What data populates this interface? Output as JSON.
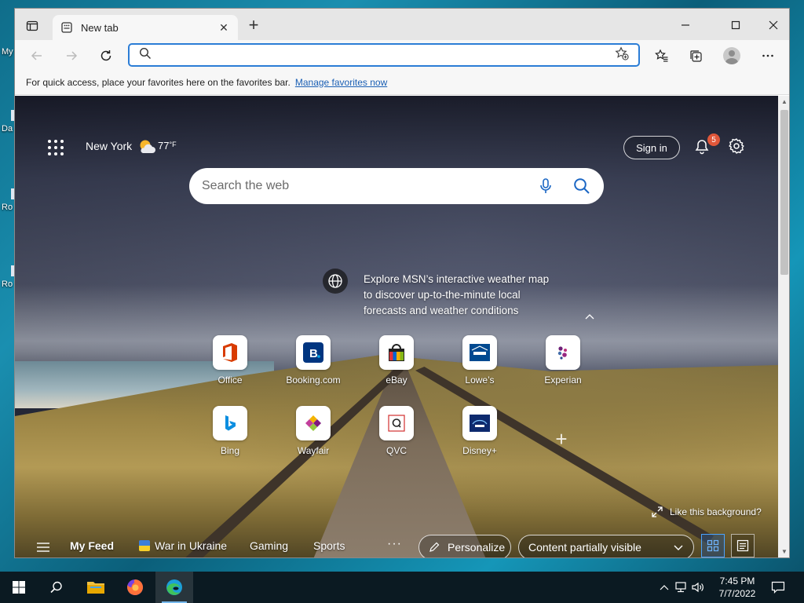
{
  "desktop": {
    "labels": [
      "My",
      "Da",
      "Ro",
      "Ro"
    ]
  },
  "browser": {
    "tab": {
      "title": "New tab"
    },
    "address": {
      "value": "",
      "placeholder": ""
    },
    "favorites_bar": {
      "message": "For quick access, place your favorites here on the favorites bar.",
      "link": "Manage favorites now"
    }
  },
  "newtab": {
    "location": "New York",
    "temperature": "77",
    "temp_unit": "°F",
    "sign_in": "Sign in",
    "notification_count": "5",
    "search": {
      "placeholder": "Search the web"
    },
    "explore": {
      "line1": "Explore MSN’s interactive weather map",
      "line2": "to discover up-to-the-minute local",
      "line3": "forecasts and weather conditions"
    },
    "quick_links": [
      {
        "label": "Office",
        "icon": "office-icon",
        "color": "#d83b01"
      },
      {
        "label": "Booking.com",
        "icon": "booking-icon",
        "color": "#003580"
      },
      {
        "label": "eBay",
        "icon": "ebay-icon",
        "color": "#e53238"
      },
      {
        "label": "Lowe’s",
        "icon": "lowes-icon",
        "color": "#004990"
      },
      {
        "label": "Experian",
        "icon": "experian-icon",
        "color": "#6d2077"
      },
      {
        "label": "Bing",
        "icon": "bing-icon",
        "color": "#0078d4"
      },
      {
        "label": "Wayfair",
        "icon": "wayfair-icon",
        "color": "#7f187f"
      },
      {
        "label": "QVC",
        "icon": "qvc-icon",
        "color": "#d32f2f"
      },
      {
        "label": "Disney+",
        "icon": "disney-plus-icon",
        "color": "#113ccf"
      }
    ],
    "like_background": "Like this background?",
    "feed": {
      "my_feed": "My Feed",
      "topics": [
        "War in Ukraine",
        "Gaming",
        "Sports"
      ],
      "more": "···",
      "personalize": "Personalize",
      "visibility": "Content partially visible"
    }
  },
  "taskbar": {
    "time": "7:45 PM",
    "date": "7/7/2022"
  },
  "colors": {
    "accent": "#2b7dd6",
    "badge": "#e0573a",
    "taskbar": "#0b1a22"
  }
}
